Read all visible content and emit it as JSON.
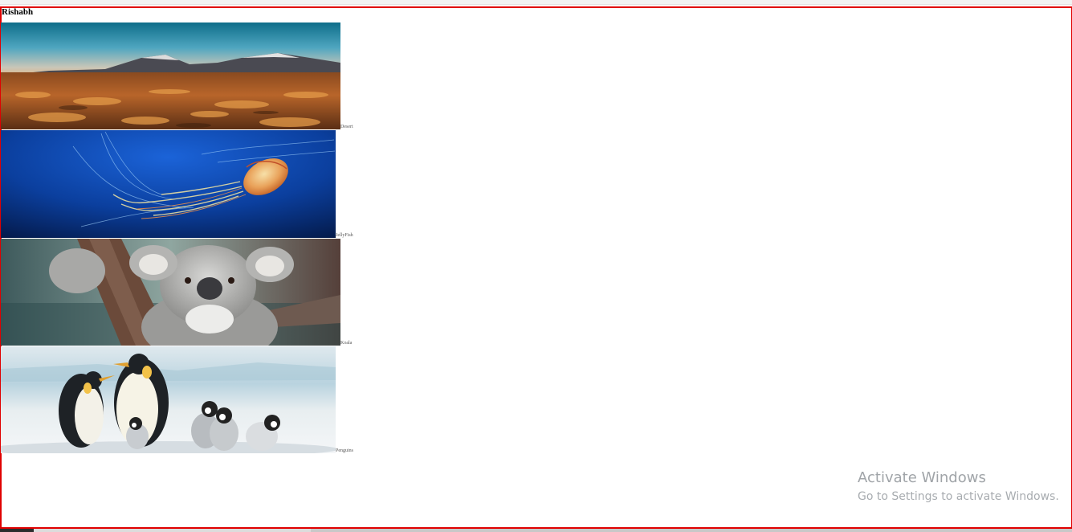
{
  "page": {
    "heading": "Rishabh"
  },
  "gallery": {
    "items": [
      {
        "caption": "Desert",
        "subject": "desert-landscape"
      },
      {
        "caption": "JellyFish",
        "subject": "jellyfish"
      },
      {
        "caption": "Koala",
        "subject": "koala"
      },
      {
        "caption": "Penguins",
        "subject": "penguins"
      }
    ]
  },
  "watermark": {
    "title": "Activate Windows",
    "subtitle": "Go to Settings to activate Windows."
  },
  "colors": {
    "frame_border": "#e00000"
  }
}
